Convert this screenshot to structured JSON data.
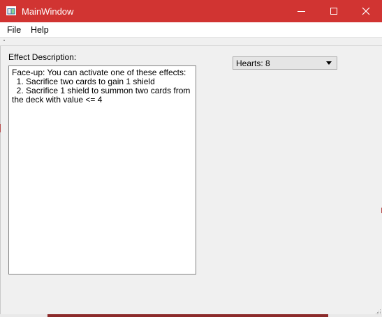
{
  "window": {
    "title": "MainWindow",
    "accent_color": "#d13432",
    "icons": {
      "app": "app-window-icon",
      "minimize": "minimize-icon",
      "maximize": "maximize-icon",
      "close": "close-icon"
    }
  },
  "menubar": {
    "items": [
      {
        "label": "File"
      },
      {
        "label": "Help"
      }
    ]
  },
  "effect": {
    "label": "Effect Description:",
    "text": "Face-up: You can activate one of these effects:\n  1. Sacrifice two cards to gain 1 shield\n  2. Sacrifice 1 shield to summon two cards from the deck with value <= 4"
  },
  "combo": {
    "selected": "Hearts: 8",
    "icon": "chevron-down-icon"
  }
}
